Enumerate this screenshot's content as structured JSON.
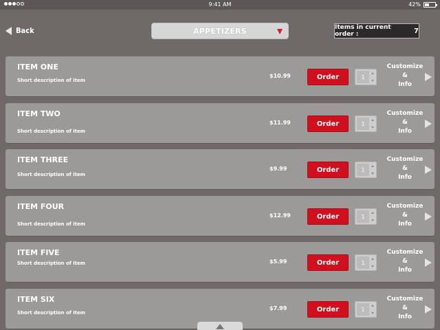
{
  "status_bar": {
    "time": "9:41 AM",
    "battery": "42%",
    "battery_level": 0.42,
    "signal_bars_filled": 3,
    "signal_bars_total": 5
  },
  "nav": {
    "back_label": "Back"
  },
  "category": {
    "selected": "APPETIZERS"
  },
  "order": {
    "label": "Items in current order :",
    "count": "7"
  },
  "item_actions": {
    "order_label": "Order",
    "customize_line1": "Customize",
    "customize_line2": "&",
    "customize_line3": "Info"
  },
  "items": [
    {
      "name": "ITEM ONE",
      "description": "Short description of item",
      "price": "$10.99",
      "qty": "1"
    },
    {
      "name": "ITEM TWO",
      "description": "Short description of item",
      "price": "$11.99",
      "qty": "1"
    },
    {
      "name": "ITEM THREE",
      "description": "Short description of item",
      "price": "$9.99",
      "qty": "1"
    },
    {
      "name": "ITEM FOUR",
      "description": "Short description of item",
      "price": "$12.99",
      "qty": "1"
    },
    {
      "name": "ITEM FIVE",
      "description": "Short description of item",
      "price": "$5.99",
      "qty": "1"
    },
    {
      "name": "ITEM SIX",
      "description": "Short description of item",
      "price": "$7.99",
      "qty": "1"
    }
  ],
  "colors": {
    "background": "#6f6a68",
    "card": "#9c9a99",
    "accent_red": "#d0101e",
    "order_box": "#2b2929"
  },
  "icons": {
    "back": "back-arrow-icon",
    "dropdown": "dropdown-caret-icon",
    "chevron": "chevron-right-icon",
    "scroll": "scroll-up-icon"
  }
}
